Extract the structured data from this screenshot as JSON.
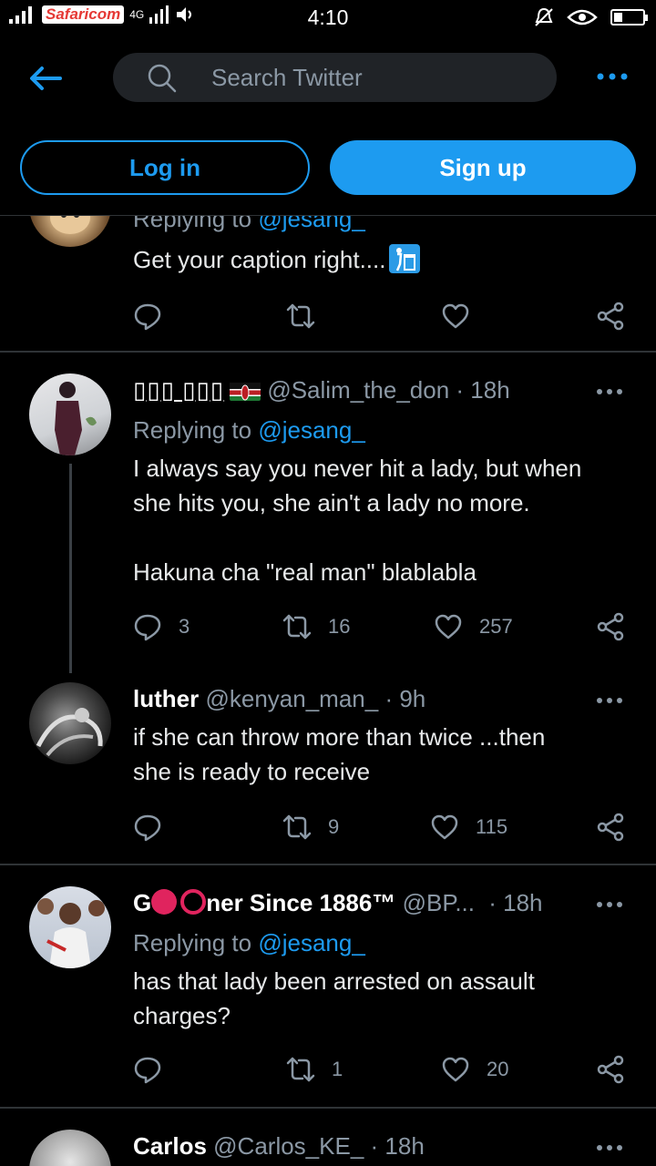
{
  "status_bar": {
    "carrier": "Safaricom",
    "network": "4G",
    "time": "4:10",
    "battery_level": 0.3
  },
  "header": {
    "search_placeholder": "Search Twitter",
    "login_label": "Log in",
    "signup_label": "Sign up"
  },
  "tweets": [
    {
      "reply_prefix": "Replying to",
      "reply_to": "@jesang_",
      "text": "Get your caption right....",
      "icon": "trash-emoji-icon"
    },
    {
      "display_name": "▯▯▯ ▯▯▯",
      "handle": "@Salim_the_don",
      "time": "· 18h",
      "reply_prefix": "Replying to",
      "reply_to": "@jesang_",
      "text_line1": "I always say you never hit a lady, but when",
      "text_line2": "she hits you, she ain't a lady no more.",
      "text_line3": "Hakuna cha \"real man\" blablabla",
      "replies": "3",
      "retweets": "16",
      "likes": "257"
    },
    {
      "display_name": "luther",
      "handle": "@kenyan_man_",
      "time": "· 9h",
      "text_line1": "if she can throw more than twice ...then",
      "text_line2": "she is ready to receive",
      "retweets": "9",
      "likes": "115"
    },
    {
      "display_name_start": "G",
      "display_name_end": "ner Since 1886™",
      "handle": "@BP...",
      "time": "· 18h",
      "reply_prefix": "Replying to",
      "reply_to": "@jesang_",
      "text_line1": "has that lady been arrested on assault",
      "text_line2": "charges?",
      "retweets": "1",
      "likes": "20"
    },
    {
      "display_name": "Carlos",
      "handle": "@Carlos_KE_",
      "time": "· 18h"
    }
  ],
  "colors": {
    "accent": "#1d9bf0",
    "background": "#000000",
    "secondary_text": "#8b98a5",
    "divider": "#2f3336",
    "red": "#e0245e"
  }
}
